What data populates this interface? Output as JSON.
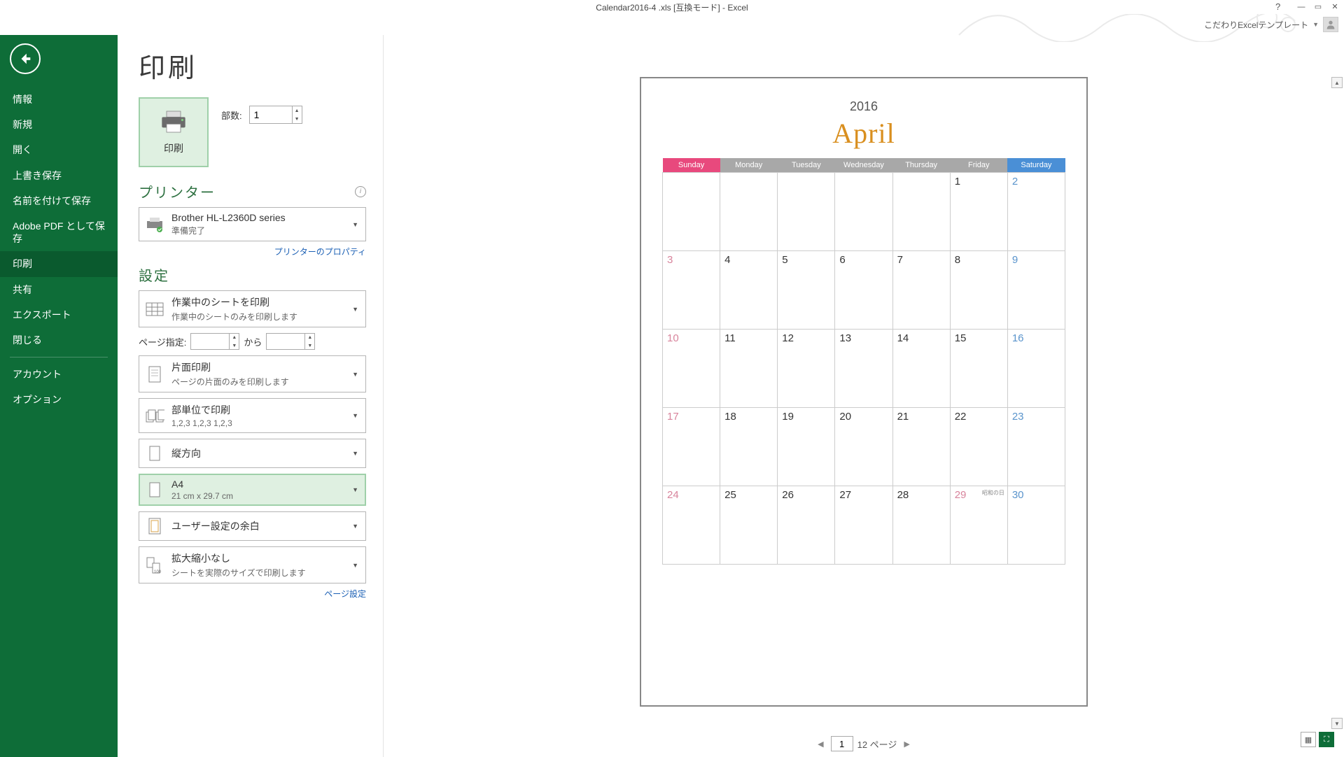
{
  "title": "Calendar2016-4 .xls  [互換モード] - Excel",
  "user_label": "こだわりExcelテンプレート",
  "sidebar": {
    "items": [
      {
        "label": "情報"
      },
      {
        "label": "新規"
      },
      {
        "label": "開く"
      },
      {
        "label": "上書き保存"
      },
      {
        "label": "名前を付けて保存"
      },
      {
        "label": "Adobe PDF として保存"
      },
      {
        "label": "印刷",
        "selected": true
      },
      {
        "label": "共有"
      },
      {
        "label": "エクスポート"
      },
      {
        "label": "閉じる"
      }
    ],
    "items2": [
      {
        "label": "アカウント"
      },
      {
        "label": "オプション"
      }
    ]
  },
  "page_heading": "印刷",
  "print_btn_label": "印刷",
  "copies_label": "部数:",
  "copies_value": "1",
  "printer_section": "プリンター",
  "printer_name": "Brother HL-L2360D series",
  "printer_status": "準備完了",
  "printer_props_link": "プリンターのプロパティ",
  "settings_section": "設定",
  "setting_sheets_main": "作業中のシートを印刷",
  "setting_sheets_sub": "作業中のシートのみを印刷します",
  "page_range_label": "ページ指定:",
  "page_range_from": "",
  "page_range_to_label": "から",
  "page_range_to": "",
  "setting_sides_main": "片面印刷",
  "setting_sides_sub": "ページの片面のみを印刷します",
  "setting_collate_main": "部単位で印刷",
  "setting_collate_sub": "1,2,3     1,2,3     1,2,3",
  "setting_orient": "縦方向",
  "setting_paper_main": "A4",
  "setting_paper_sub": "21 cm x 29.7 cm",
  "setting_margins": "ユーザー設定の余白",
  "setting_scale_main": "拡大縮小なし",
  "setting_scale_sub": "シートを実際のサイズで印刷します",
  "page_setup_link": "ページ設定",
  "calendar": {
    "year": "2016",
    "month": "April",
    "dow": [
      "Sunday",
      "Monday",
      "Tuesday",
      "Wednesday",
      "Thursday",
      "Friday",
      "Saturday"
    ],
    "holiday_label": "昭和の日",
    "weeks": [
      [
        "",
        "",
        "",
        "",
        "",
        "1",
        "2"
      ],
      [
        "3",
        "4",
        "5",
        "6",
        "7",
        "8",
        "9"
      ],
      [
        "10",
        "11",
        "12",
        "13",
        "14",
        "15",
        "16"
      ],
      [
        "17",
        "18",
        "19",
        "20",
        "21",
        "22",
        "23"
      ],
      [
        "24",
        "25",
        "26",
        "27",
        "28",
        "29",
        "30"
      ]
    ]
  },
  "footer": {
    "current_page": "1",
    "total_label": "12 ページ"
  }
}
